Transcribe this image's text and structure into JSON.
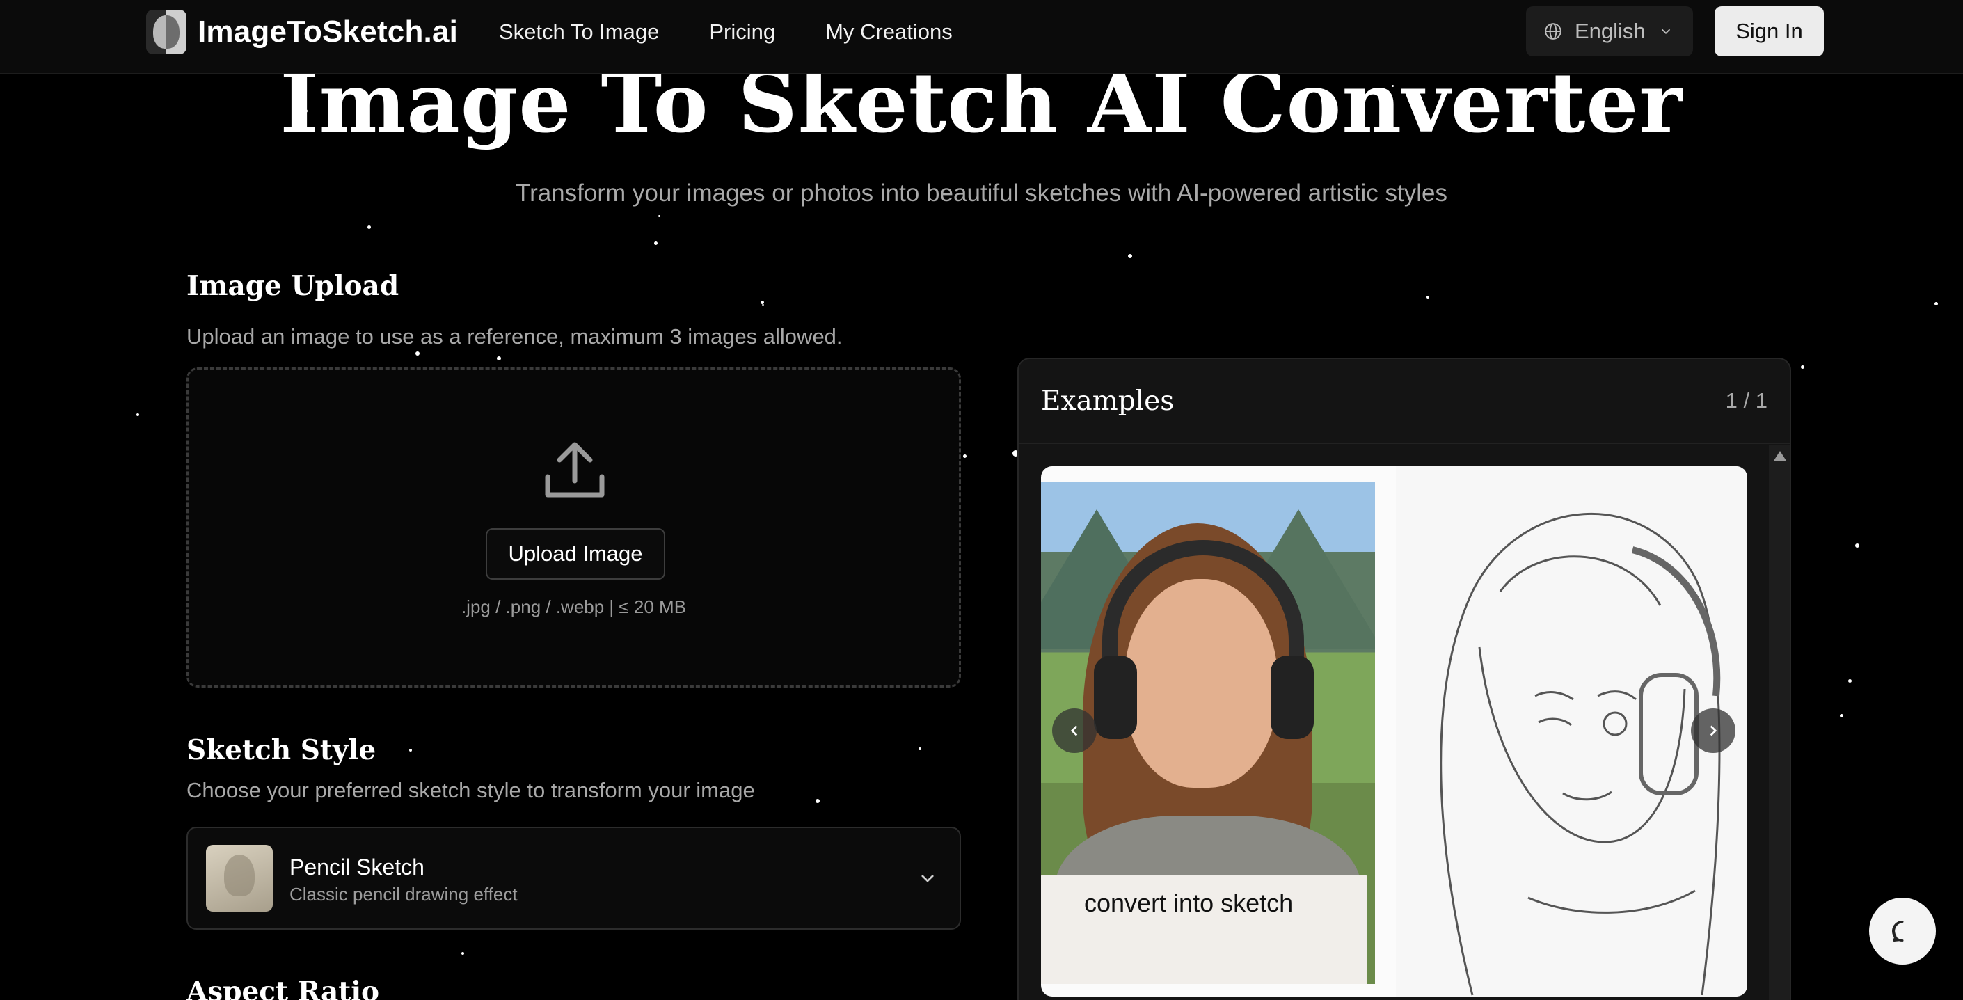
{
  "header": {
    "brand": "ImageToSketch.ai",
    "nav": [
      "Sketch To Image",
      "Pricing",
      "My Creations"
    ],
    "language": "English",
    "sign_in": "Sign In"
  },
  "hero": {
    "title": "Image To Sketch AI Converter",
    "subtitle": "Transform your images or photos into beautiful sketches with AI-powered artistic styles"
  },
  "upload": {
    "title": "Image Upload",
    "description": "Upload an image to use as a reference, maximum 3 images allowed.",
    "button": "Upload Image",
    "hint": ".jpg / .png / .webp   |   ≤ 20 MB"
  },
  "sketch_style": {
    "title": "Sketch Style",
    "description": "Choose your preferred sketch style to transform your image",
    "selected_name": "Pencil Sketch",
    "selected_desc": "Classic pencil drawing effect"
  },
  "aspect_ratio": {
    "title": "Aspect Ratio"
  },
  "examples": {
    "title": "Examples",
    "counter": "1 / 1",
    "caption": "convert into sketch"
  },
  "icons": {
    "language": "globe-icon",
    "dropdown": "chevron-down-icon",
    "upload": "upload-icon",
    "prev": "chevron-left-icon",
    "next": "chevron-right-icon",
    "chat": "chat-bubble-icon"
  }
}
